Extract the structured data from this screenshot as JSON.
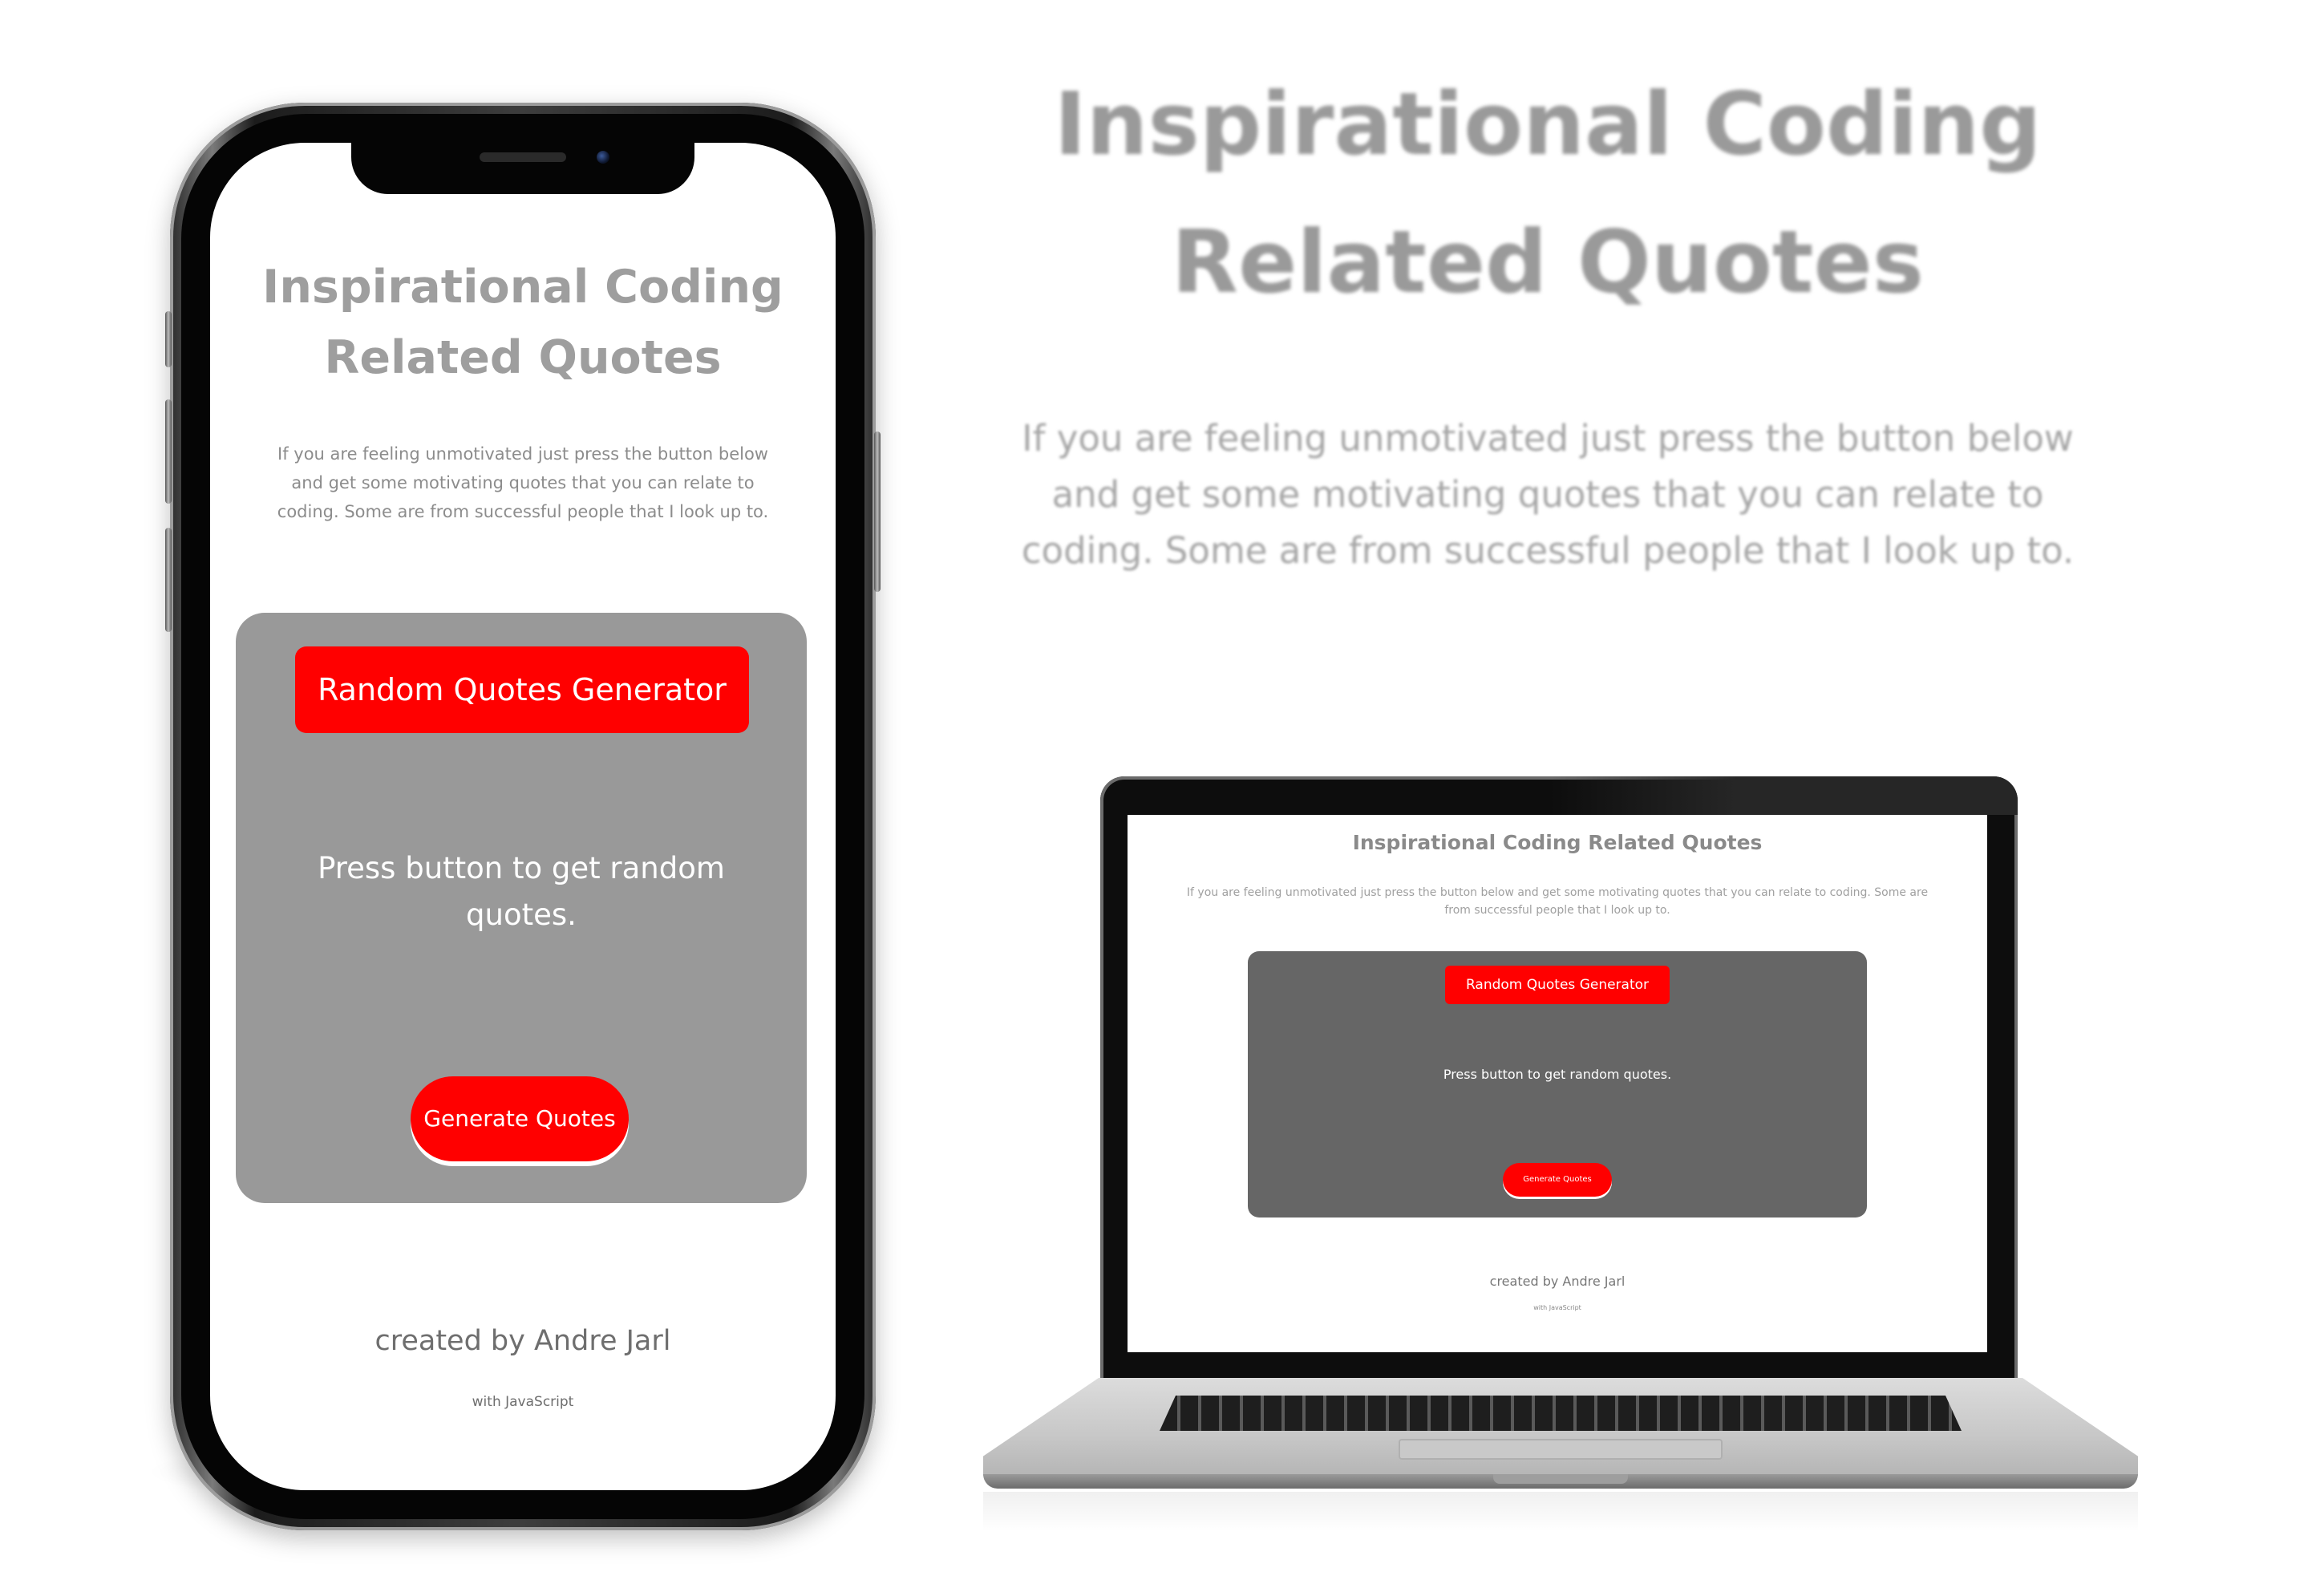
{
  "hero": {
    "title": "Inspirational Coding Related Quotes",
    "description": "If you are feeling unmotivated just press the button below and get some motivating quotes that you can relate to coding. Some are from successful people that I look up to."
  },
  "app": {
    "title": "Inspirational Coding Related Quotes",
    "description": "If you are feeling unmotivated just press the button below and get some motivating quotes that you can relate to coding. Some are from successful people that I look up to.",
    "generator_title": "Random Quotes Generator",
    "quote_placeholder": "Press button to get random quotes.",
    "generate_button": "Generate Quotes",
    "credit": "created by Andre Jarl",
    "credit_sub": "with JavaScript"
  },
  "colors": {
    "accent_red": "#ff0000",
    "heading_gray": "#9e9e9e",
    "card_gray_mobile": "#999999",
    "card_gray_desktop": "#666666"
  }
}
